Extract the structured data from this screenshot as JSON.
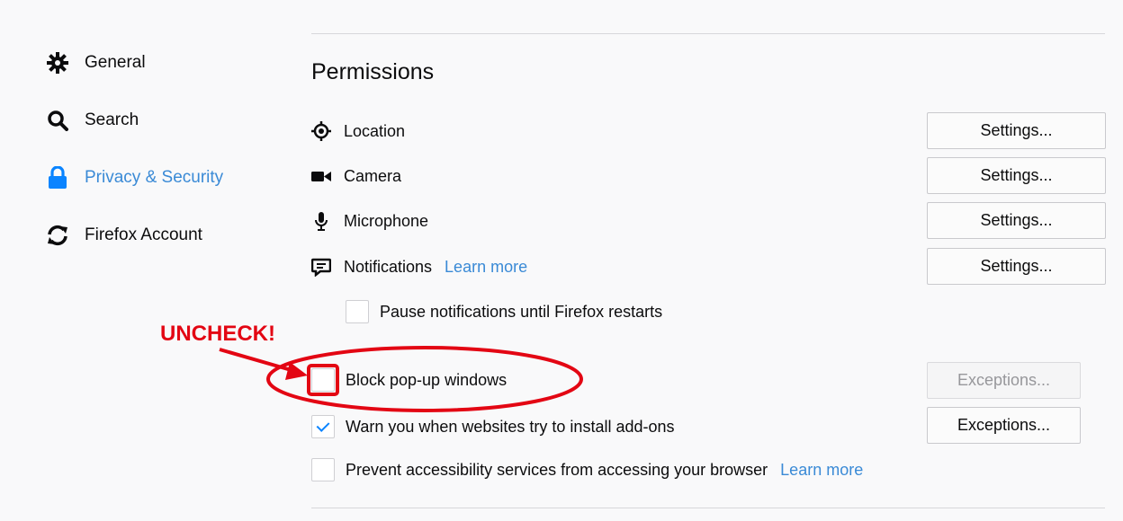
{
  "sidebar": {
    "items": [
      {
        "label": "General",
        "icon": "gear-icon",
        "selected": false
      },
      {
        "label": "Search",
        "icon": "search-icon",
        "selected": false
      },
      {
        "label": "Privacy & Security",
        "icon": "lock-icon",
        "selected": true
      },
      {
        "label": "Firefox Account",
        "icon": "sync-icon",
        "selected": false
      }
    ]
  },
  "permissions": {
    "title": "Permissions",
    "rows": [
      {
        "label": "Location",
        "icon": "location-icon",
        "button": "Settings..."
      },
      {
        "label": "Camera",
        "icon": "camera-icon",
        "button": "Settings..."
      },
      {
        "label": "Microphone",
        "icon": "microphone-icon",
        "button": "Settings..."
      },
      {
        "label": "Notifications",
        "icon": "notifications-icon",
        "button": "Settings...",
        "link": "Learn more"
      }
    ],
    "pause_notifications": {
      "label": "Pause notifications until Firefox restarts",
      "checked": false
    },
    "block_popups": {
      "label": "Block pop-up windows",
      "checked": false,
      "button": "Exceptions...",
      "button_disabled": true
    },
    "warn_addons": {
      "label": "Warn you when websites try to install add-ons",
      "checked": true,
      "button": "Exceptions..."
    },
    "prevent_accessibility": {
      "label": "Prevent accessibility services from accessing your browser",
      "checked": false,
      "link": "Learn more"
    }
  },
  "annotation": {
    "text": "UNCHECK!",
    "color": "#e30613"
  },
  "colors": {
    "accent": "#0a84ff",
    "link": "#3a8ad6",
    "background": "#f9f9fa"
  }
}
